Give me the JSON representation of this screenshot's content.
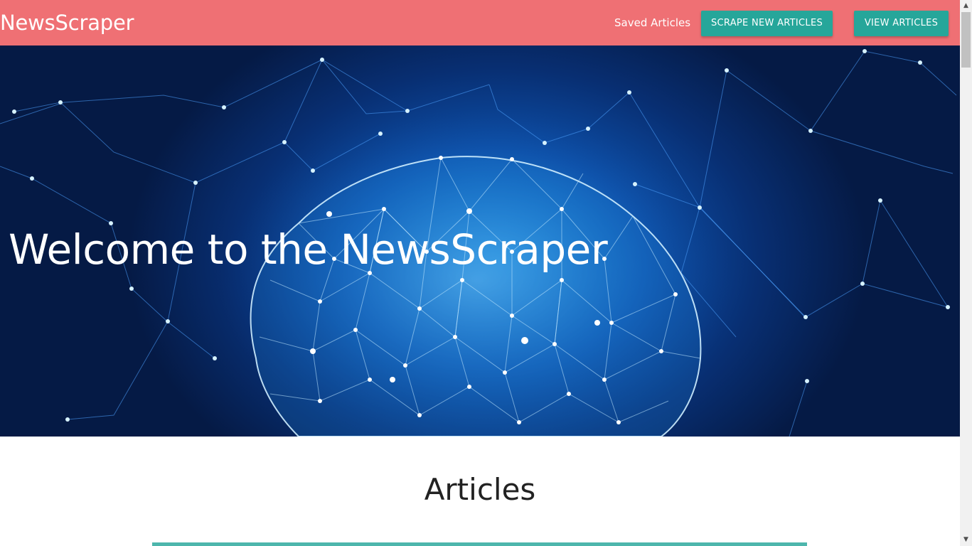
{
  "navbar": {
    "brand": "NewsScraper",
    "saved_link": "Saved Articles",
    "scrape_button": "SCRAPE NEW ARTICLES",
    "view_button": "VIEW ARTICLES"
  },
  "hero": {
    "title": "Welcome to the NewsScraper"
  },
  "main": {
    "heading": "Articles"
  },
  "scrollbar": {
    "up_icon": "▲",
    "down_icon": "▼"
  },
  "colors": {
    "navbar": "#ef7074",
    "button": "#26a69a",
    "article_accent": "#4db6ac"
  }
}
